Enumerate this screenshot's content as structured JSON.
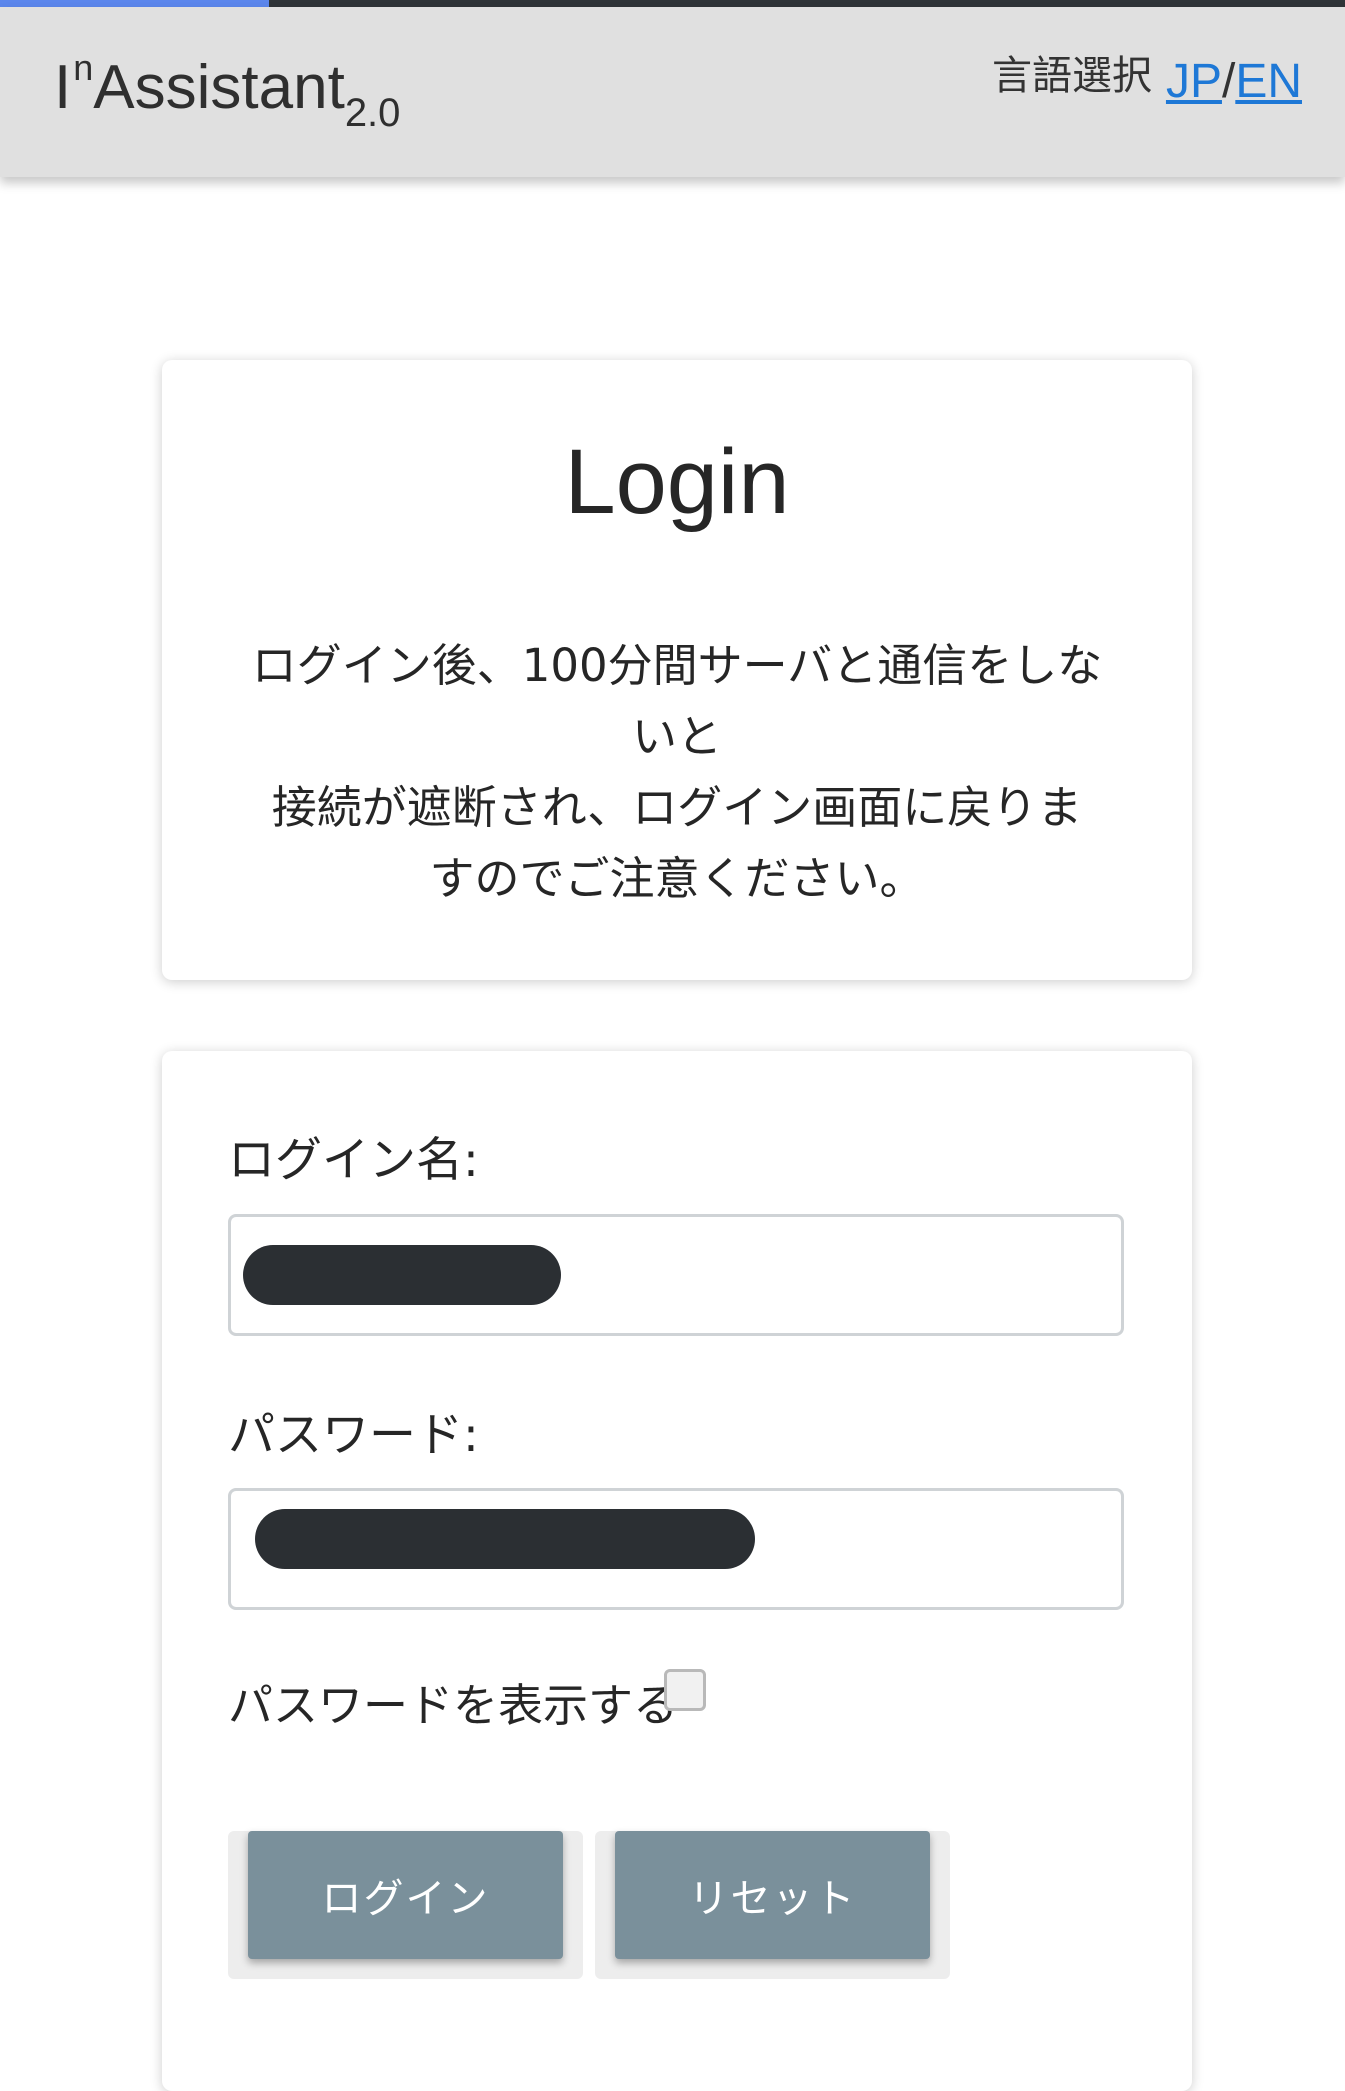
{
  "progress": {
    "fraction": 0.2
  },
  "header": {
    "app_name": "I",
    "app_name_sup": "n",
    "app_name_main": "Assistant",
    "app_version": "2.0",
    "lang_label": "言語選択",
    "lang_jp": "JP",
    "lang_sep": "/",
    "lang_en": "EN"
  },
  "login_card": {
    "title": "Login",
    "notice_lines": [
      "ログイン後、100分間サーバと通信をしな",
      "いと",
      "接続が遮断され、ログイン画面に戻りま",
      "すのでご注意ください。"
    ]
  },
  "form": {
    "login_name_label": "ログイン名:",
    "login_name_value": "",
    "password_label": "パスワード:",
    "password_value": "",
    "show_password_label": "パスワードを表示する",
    "show_password_checked": false,
    "login_button": "ログイン",
    "reset_button": "リセット"
  }
}
